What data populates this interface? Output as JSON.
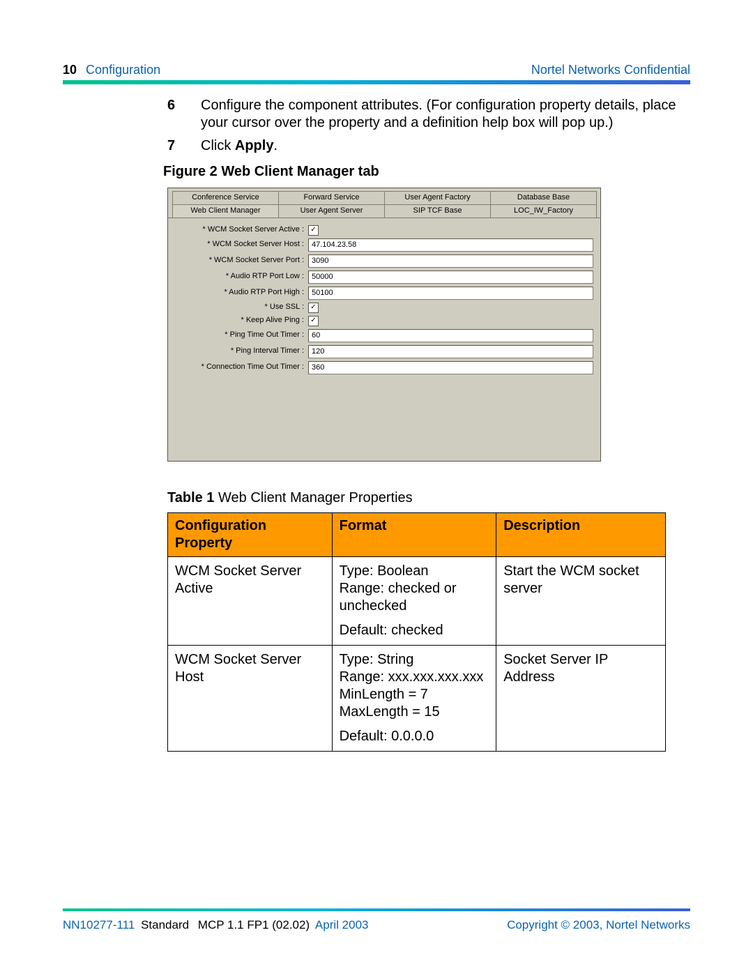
{
  "header": {
    "page_number": "10",
    "section": "Configuration",
    "confidential": "Nortel Networks Confidential"
  },
  "steps": [
    {
      "num": "6",
      "text": "Configure the component attributes. (For configuration property details, place your cursor over the property and a definition help box will pop up.)"
    },
    {
      "num": "7",
      "text_prefix": "Click ",
      "text_bold": "Apply",
      "text_suffix": "."
    }
  ],
  "figure_caption": "Figure 2  Web Client Manager tab",
  "wcm": {
    "tabs_row1": [
      "Conference  Service",
      "Forward Service",
      "User Agent Factory",
      "Database Base"
    ],
    "tabs_row2": [
      "Web Client Manager",
      "User Agent Server",
      "SIP TCF Base",
      "LOC_IW_Factory"
    ],
    "fields": [
      {
        "label": "* WCM Socket Server Active :",
        "type": "check",
        "value": true
      },
      {
        "label": "* WCM Socket Server Host :",
        "type": "text",
        "value": "47.104.23.58"
      },
      {
        "label": "* WCM Socket Server Port :",
        "type": "text",
        "value": "3090"
      },
      {
        "label": "* Audio RTP Port Low :",
        "type": "text",
        "value": "50000"
      },
      {
        "label": "* Audio RTP Port High :",
        "type": "text",
        "value": "50100"
      },
      {
        "label": "* Use SSL :",
        "type": "check",
        "value": true
      },
      {
        "label": "* Keep Alive Ping :",
        "type": "check",
        "value": true
      },
      {
        "label": "* Ping Time Out Timer :",
        "type": "text",
        "value": "60"
      },
      {
        "label": "* Ping Interval Timer :",
        "type": "text",
        "value": "120"
      },
      {
        "label": "* Connection Time Out Timer :",
        "type": "text",
        "value": "360"
      }
    ]
  },
  "table_caption_bold": "Table 1",
  "table_caption_rest": "  Web Client Manager Properties",
  "table": {
    "headers": [
      "Configuration Property",
      "Format",
      "Description"
    ],
    "rows": [
      {
        "prop": "WCM Socket Server Active",
        "format": "Type: Boolean\nRange: checked or unchecked\nDefault: checked",
        "desc": "Start the WCM socket server"
      },
      {
        "prop": "WCM Socket Server Host",
        "format": "Type: String\nRange: xxx.xxx.xxx.xxx\nMinLength = 7\nMaxLength = 15\nDefault: 0.0.0.0",
        "desc": "Socket Server IP Address"
      }
    ]
  },
  "footer": {
    "doc_id": "NN10277-111",
    "standard": "Standard",
    "version": "MCP 1.1 FP1 (02.02)",
    "date": "April 2003",
    "copyright": "Copyright © 2003, Nortel Networks"
  }
}
